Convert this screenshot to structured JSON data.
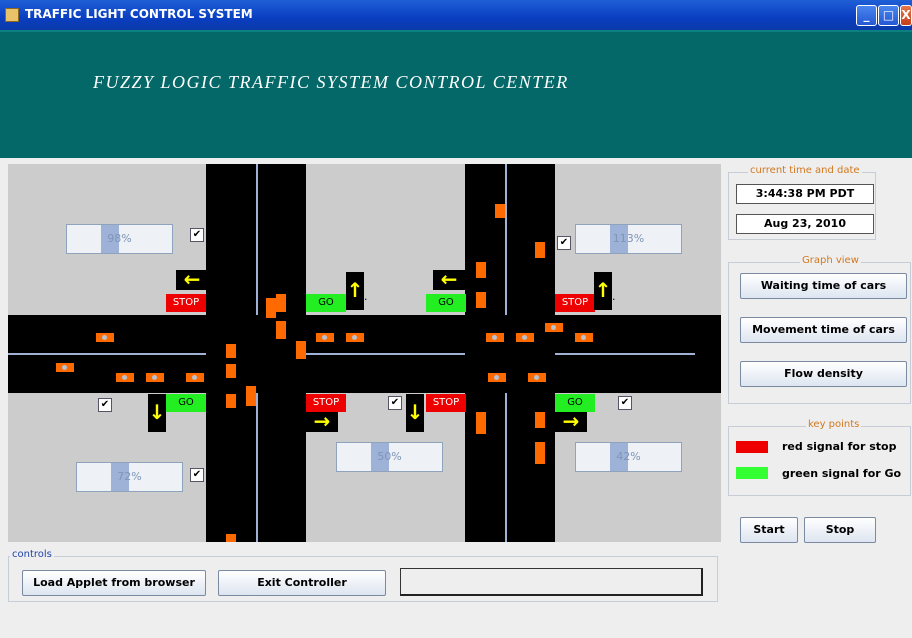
{
  "window": {
    "title": "TRAFFIC LIGHT CONTROL SYSTEM",
    "min": "_",
    "max": "□",
    "close": "X"
  },
  "header": {
    "title": "FUZZY LOGIC TRAFFIC SYSTEM CONTROL  CENTER"
  },
  "signals": {
    "stop": "STOP",
    "go": "GO"
  },
  "arrows": {
    "left": "←",
    "right": "→",
    "up": "↑",
    "down": "↓"
  },
  "density": [
    {
      "label": "98%",
      "value": 0.98
    },
    {
      "label": "113%",
      "value": 1.13
    },
    {
      "label": "72%",
      "value": 0.72
    },
    {
      "label": "50%",
      "value": 0.5
    },
    {
      "label": "42%",
      "value": 0.42
    }
  ],
  "checkbox_mark": "✔",
  "time_panel": {
    "legend": "current time and date",
    "time": "3:44:38 PM PDT",
    "date": "Aug 23, 2010"
  },
  "graph_panel": {
    "legend": "Graph view",
    "waiting": "Waiting time of cars",
    "movement": "Movement time of cars",
    "flow": "Flow density"
  },
  "key_panel": {
    "legend": "key points",
    "red_label": "red signal for stop",
    "green_label": "green signal for Go",
    "red_color": "#ee0000",
    "green_color": "#33ff33"
  },
  "run": {
    "start": "Start",
    "stop": "Stop"
  },
  "controls": {
    "legend": "controls",
    "load": "Load Applet from browser",
    "exit": "Exit Controller",
    "status_value": ""
  },
  "colors": {
    "header_bg": "#056868",
    "car": "#ff6a00",
    "road": "#000000"
  }
}
